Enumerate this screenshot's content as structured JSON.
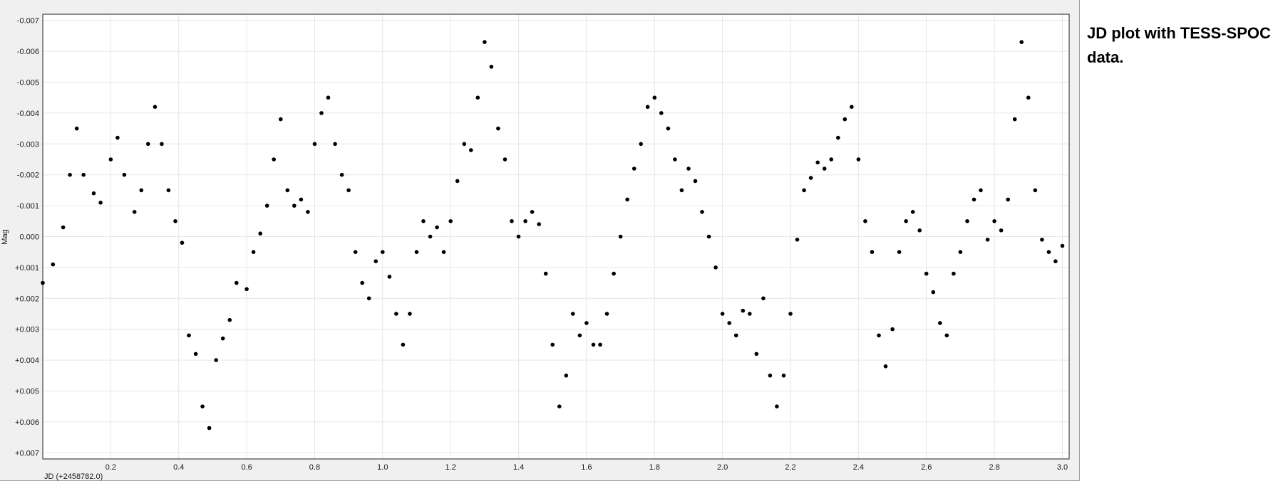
{
  "caption": {
    "text": "JD plot with TESS-SPOC data."
  },
  "chart_data": {
    "type": "scatter",
    "title": "",
    "xlabel": "JD (+2458782.0)",
    "ylabel": "Mag",
    "xlim": [
      0.0,
      3.02
    ],
    "ylim": [
      -0.0072,
      0.0072
    ],
    "y_inverted": true,
    "grid": true,
    "marker_color": "#000000",
    "x_ticks": [
      {
        "value": 0.2,
        "label": "0.2"
      },
      {
        "value": 0.4,
        "label": "0.4"
      },
      {
        "value": 0.6,
        "label": "0.6"
      },
      {
        "value": 0.8,
        "label": "0.8"
      },
      {
        "value": 1.0,
        "label": "1.0"
      },
      {
        "value": 1.2,
        "label": "1.2"
      },
      {
        "value": 1.4,
        "label": "1.4"
      },
      {
        "value": 1.6,
        "label": "1.6"
      },
      {
        "value": 1.8,
        "label": "1.8"
      },
      {
        "value": 2.0,
        "label": "2.0"
      },
      {
        "value": 2.2,
        "label": "2.2"
      },
      {
        "value": 2.4,
        "label": "2.4"
      },
      {
        "value": 2.6,
        "label": "2.6"
      },
      {
        "value": 2.8,
        "label": "2.8"
      },
      {
        "value": 3.0,
        "label": "3.0"
      }
    ],
    "y_ticks": [
      {
        "value": -0.007,
        "label": "-0.007"
      },
      {
        "value": -0.006,
        "label": "-0.006"
      },
      {
        "value": -0.005,
        "label": "-0.005"
      },
      {
        "value": -0.004,
        "label": "-0.004"
      },
      {
        "value": -0.003,
        "label": "-0.003"
      },
      {
        "value": -0.002,
        "label": "-0.002"
      },
      {
        "value": -0.001,
        "label": "-0.001"
      },
      {
        "value": 0.0,
        "label": "0.000"
      },
      {
        "value": 0.001,
        "label": "+0.001"
      },
      {
        "value": 0.002,
        "label": "+0.002"
      },
      {
        "value": 0.003,
        "label": "+0.003"
      },
      {
        "value": 0.004,
        "label": "+0.004"
      },
      {
        "value": 0.005,
        "label": "+0.005"
      },
      {
        "value": 0.006,
        "label": "+0.006"
      },
      {
        "value": 0.007,
        "label": "+0.007"
      }
    ],
    "series": [
      {
        "marker": "circle",
        "x": [
          0.0,
          0.03,
          0.06,
          0.08,
          0.1,
          0.12,
          0.15,
          0.17,
          0.2,
          0.22,
          0.24,
          0.27,
          0.29,
          0.31,
          0.33,
          0.35,
          0.37,
          0.39,
          0.41,
          0.43,
          0.45,
          0.47,
          0.49,
          0.51,
          0.53,
          0.55,
          0.57,
          0.6,
          0.62,
          0.64,
          0.66,
          0.68,
          0.7,
          0.72,
          0.74,
          0.76,
          0.78,
          0.8,
          0.82,
          0.84,
          0.86,
          0.88,
          0.9,
          0.92,
          0.94,
          0.96,
          0.98,
          1.0,
          1.02,
          1.04,
          1.06,
          1.08,
          1.1,
          1.12,
          1.14,
          1.16,
          1.18,
          1.2,
          1.22,
          1.24,
          1.26,
          1.28,
          1.3,
          1.32,
          1.34,
          1.36,
          1.38,
          1.4,
          1.42,
          1.44,
          1.46,
          1.48,
          1.5,
          1.52,
          1.54,
          1.56,
          1.58,
          1.6,
          1.62,
          1.64,
          1.66,
          1.68,
          1.7,
          1.72,
          1.74,
          1.76,
          1.78,
          1.8,
          1.82,
          1.84,
          1.86,
          1.88,
          1.9,
          1.92,
          1.94,
          1.96,
          1.98,
          2.0,
          2.02,
          2.04,
          2.06,
          2.08,
          2.1,
          2.12,
          2.14,
          2.16,
          2.18,
          2.2,
          2.22,
          2.24,
          2.26,
          2.28,
          2.3,
          2.32,
          2.34,
          2.36,
          2.38,
          2.4,
          2.42,
          2.44,
          2.46,
          2.48,
          2.5,
          2.52,
          2.54,
          2.56,
          2.58,
          2.6,
          2.62,
          2.64,
          2.66,
          2.68,
          2.7,
          2.72,
          2.74,
          2.76,
          2.78,
          2.8,
          2.82,
          2.84,
          2.86,
          2.88,
          2.9,
          2.92,
          2.94,
          2.96,
          2.98,
          3.0
        ],
        "y": [
          0.0015,
          0.0009,
          -0.0003,
          -0.002,
          -0.0035,
          -0.002,
          -0.0014,
          -0.0011,
          -0.0025,
          -0.0032,
          -0.002,
          -0.0008,
          -0.0015,
          -0.003,
          -0.0042,
          -0.003,
          -0.0015,
          -0.0005,
          0.0002,
          0.0032,
          0.0038,
          0.0055,
          0.0062,
          0.004,
          0.0033,
          0.0027,
          0.0015,
          0.0017,
          0.0005,
          -0.0001,
          -0.001,
          -0.0025,
          -0.0038,
          -0.0015,
          -0.001,
          -0.0012,
          -0.0008,
          -0.003,
          -0.004,
          -0.0045,
          -0.003,
          -0.002,
          -0.0015,
          0.0005,
          0.0015,
          0.002,
          0.0008,
          0.0005,
          0.0013,
          0.0025,
          0.0035,
          0.0025,
          0.0005,
          -0.0005,
          0.0,
          -0.0003,
          0.0005,
          -0.0005,
          -0.0018,
          -0.003,
          -0.0028,
          -0.0045,
          -0.0063,
          -0.0055,
          -0.0035,
          -0.0025,
          -0.0005,
          0.0,
          -0.0005,
          -0.0008,
          -0.0004,
          0.0012,
          0.0035,
          0.0055,
          0.0045,
          0.0025,
          0.0032,
          0.0028,
          0.0035,
          0.0035,
          0.0025,
          0.0012,
          0.0,
          -0.0012,
          -0.0022,
          -0.003,
          -0.0042,
          -0.0045,
          -0.004,
          -0.0035,
          -0.0025,
          -0.0015,
          -0.0022,
          -0.0018,
          -0.0008,
          0.0,
          0.001,
          0.0025,
          0.0028,
          0.0032,
          0.0024,
          0.0025,
          0.0038,
          0.002,
          0.0045,
          0.0055,
          0.0045,
          0.0025,
          0.0001,
          -0.0015,
          -0.0019,
          -0.0024,
          -0.0022,
          -0.0025,
          -0.0032,
          -0.0038,
          -0.0042,
          -0.0025,
          -0.0005,
          0.0005,
          0.0032,
          0.0042,
          0.003,
          0.0005,
          -0.0005,
          -0.0008,
          -0.0002,
          0.0012,
          0.0018,
          0.0028,
          0.0032,
          0.0012,
          0.0005,
          -0.0005,
          -0.0012,
          -0.0015,
          0.0001,
          -0.0005,
          -0.0002,
          -0.0012,
          -0.0038,
          -0.0063,
          -0.0045,
          -0.0015,
          0.0001,
          0.0005,
          0.0008,
          0.0003
        ]
      }
    ]
  }
}
